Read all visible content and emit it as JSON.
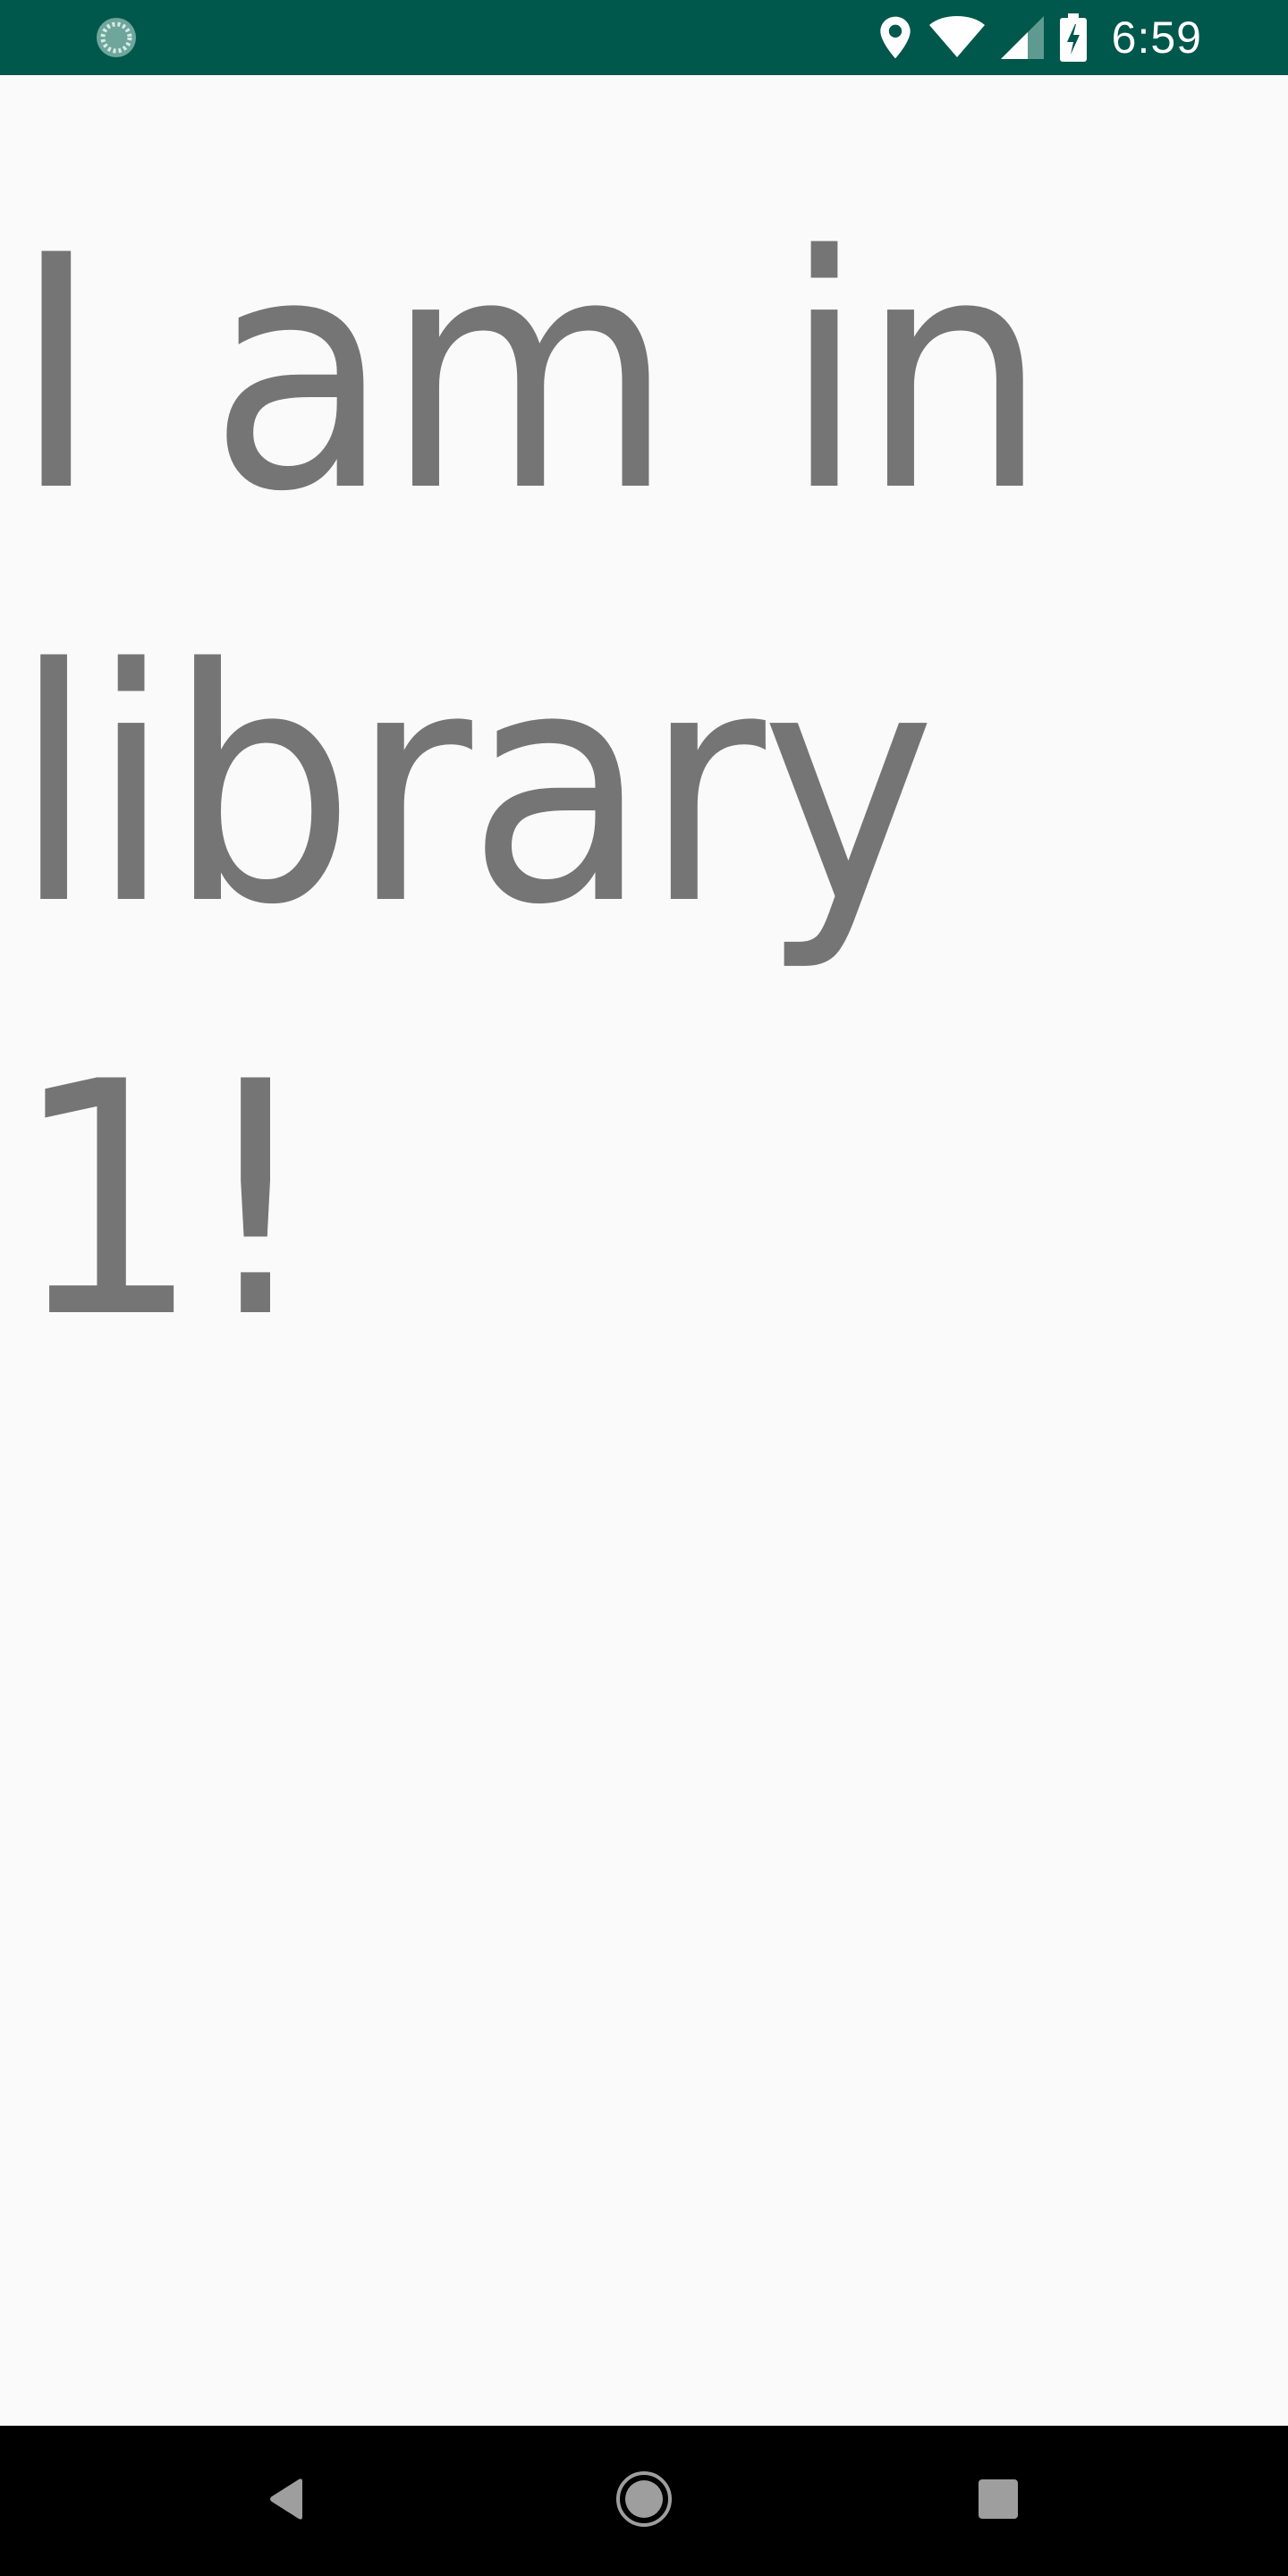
{
  "status_bar": {
    "time": "6:59",
    "background_color": "#00574b",
    "icons": [
      "app-notification-icon",
      "location-pin-icon",
      "wifi-icon",
      "cell-signal-icon",
      "battery-charging-icon"
    ]
  },
  "main": {
    "text": "I am in library 1!",
    "text_color": "#757575",
    "background_color": "#fafafa"
  },
  "nav_bar": {
    "buttons": [
      "back-icon",
      "home-icon",
      "recents-icon"
    ],
    "icon_color": "#9e9e9e"
  }
}
